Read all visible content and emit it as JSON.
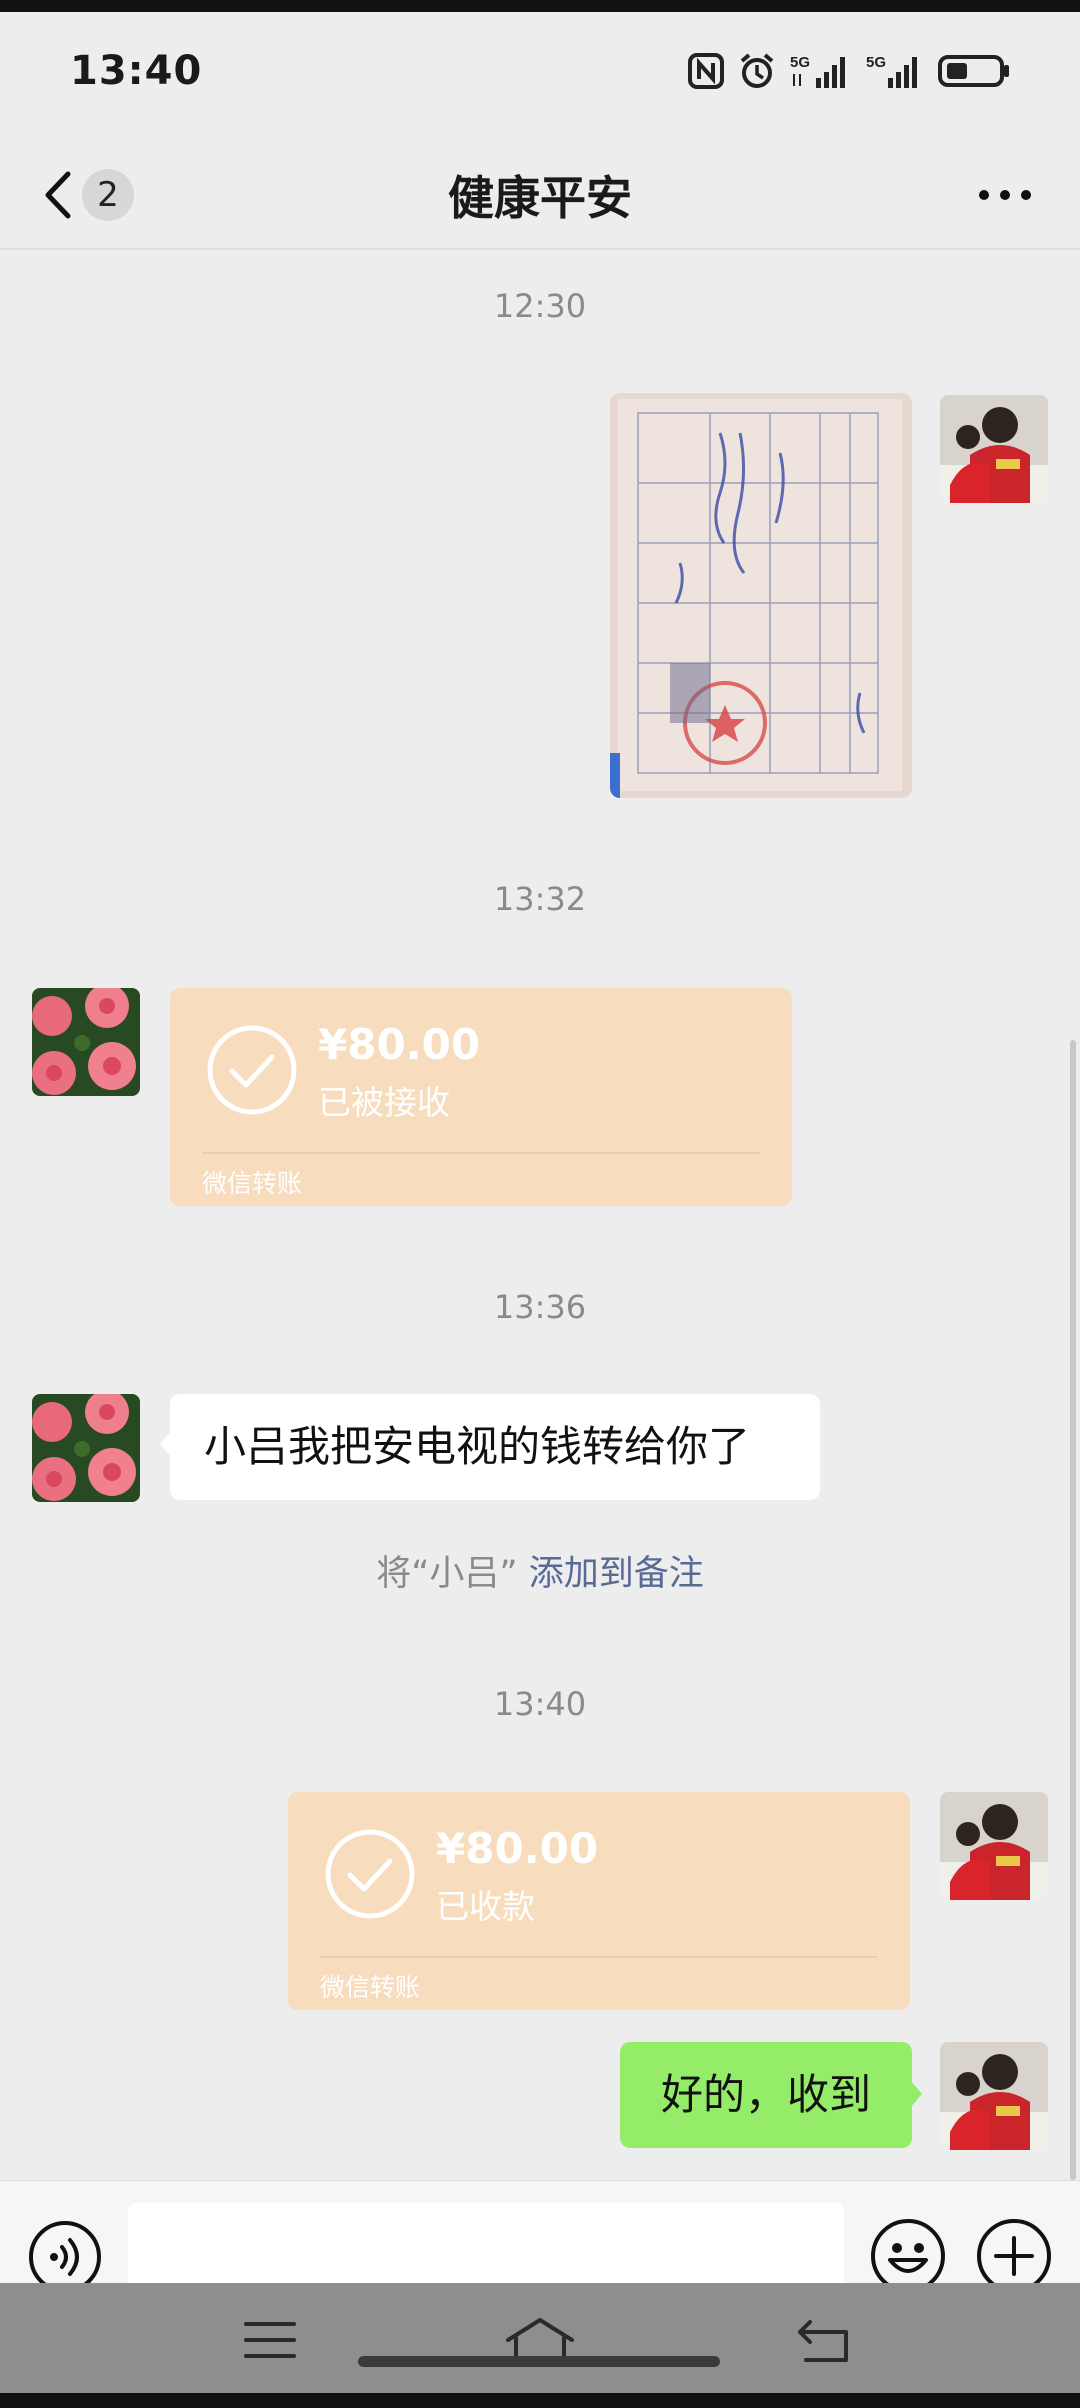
{
  "status_bar": {
    "time": "13:40",
    "icons": [
      "nfc-icon",
      "alarm-icon",
      "5g-signal-icon",
      "5g-signal-icon",
      "battery-icon"
    ],
    "network_labels": [
      "5G",
      "5G"
    ]
  },
  "header": {
    "unread_count": "2",
    "title": "健康平安",
    "more_icon": "more-dots-icon"
  },
  "messages": [
    {
      "type": "timestamp",
      "text": "12:30"
    },
    {
      "type": "image",
      "side": "right",
      "description": "receipt-photo"
    },
    {
      "type": "timestamp",
      "text": "13:32"
    },
    {
      "type": "transfer",
      "side": "left",
      "amount": "¥80.00",
      "status": "已被接收",
      "footer": "微信转账"
    },
    {
      "type": "timestamp",
      "text": "13:36"
    },
    {
      "type": "text",
      "side": "left",
      "text": "小吕我把安电视的钱转给你了"
    },
    {
      "type": "system",
      "prefix": "将“小吕”",
      "link": "添加到备注"
    },
    {
      "type": "timestamp",
      "text": "13:40"
    },
    {
      "type": "transfer",
      "side": "right",
      "amount": "¥80.00",
      "status": "已收款",
      "footer": "微信转账"
    },
    {
      "type": "text",
      "side": "right",
      "text": "好的，收到"
    }
  ],
  "input_bar": {
    "voice_icon": "voice-icon",
    "input_value": "",
    "emoji_icon": "emoji-icon",
    "plus_icon": "plus-icon"
  },
  "nav_bar": {
    "icons": [
      "menu-icon",
      "home-icon",
      "back-icon"
    ]
  },
  "colors": {
    "background": "#ededed",
    "transfer_bg": "#f7dcbd",
    "self_bubble": "#95ec69",
    "link": "#576b95"
  }
}
